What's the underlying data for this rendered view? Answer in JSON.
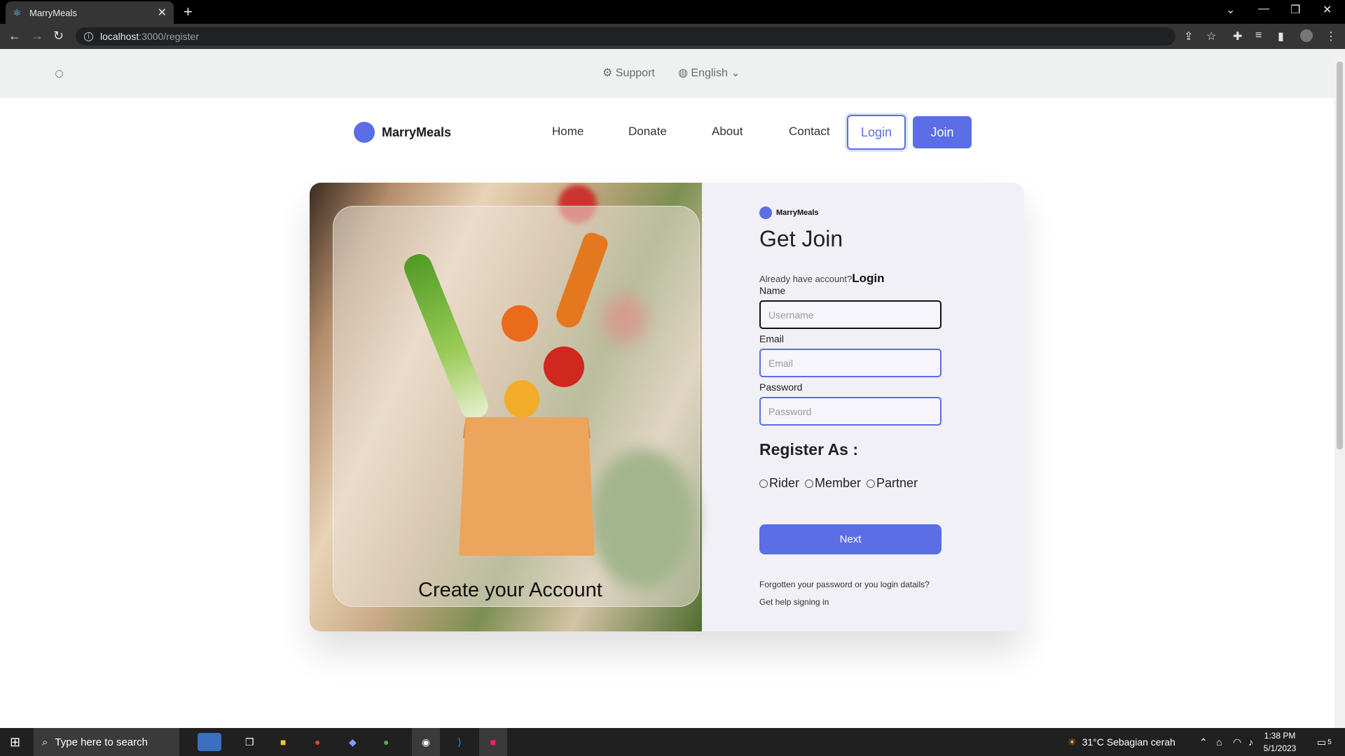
{
  "browser": {
    "tab_title": "MarryMeals",
    "tab_close": "✕",
    "new_tab": "+",
    "url_host": "localhost",
    "url_rest": ":3000/register"
  },
  "site": {
    "support_label": "Support",
    "language_label": "English",
    "brand_name": "MarryMeals",
    "nav": [
      "Home",
      "Donate",
      "About",
      "Contact"
    ],
    "login_button": "Login",
    "join_button": "Join"
  },
  "hero": {
    "caption": "Create your Account"
  },
  "form": {
    "brand_name": "MarryMeals",
    "title": "Get Join",
    "already_text": "Already have account?",
    "login_link": "Login",
    "name_label": "Name",
    "name_placeholder": "Username",
    "email_label": "Email",
    "email_placeholder": "Email",
    "password_label": "Password",
    "password_placeholder": "Password",
    "register_as": "Register As :",
    "roles": [
      "Rider",
      "Member",
      "Partner"
    ],
    "next_button": "Next",
    "forgot_text": "Forgotten your password or you login datails?Get help signing in"
  },
  "taskbar": {
    "search_placeholder": "Type here to search",
    "weather": "31°C  Sebagian cerah",
    "time": "1:38 PM",
    "date": "5/1/2023",
    "notifications": "5"
  },
  "colors": {
    "accent": "#5b6ee6"
  }
}
